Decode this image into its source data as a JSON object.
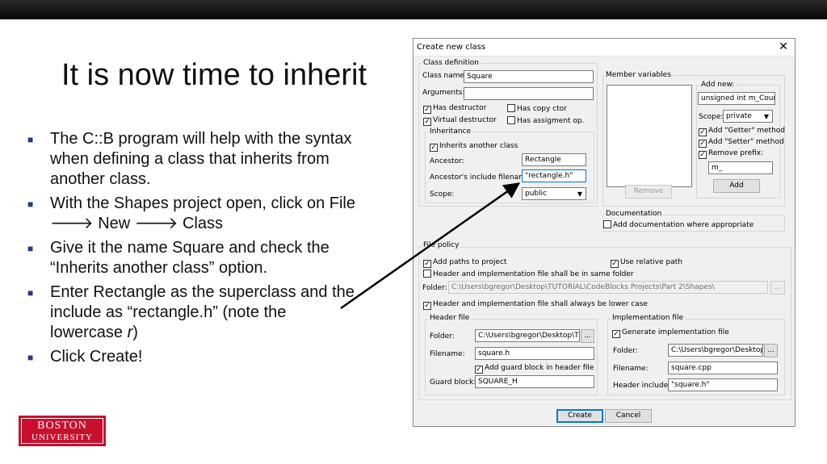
{
  "slide": {
    "title": "It is now time to inherit",
    "bullets": [
      "The C::B program will help with the syntax when defining a class that inherits from another class.",
      "With the Shapes project open, click on File",
      "Give it the name Square and check the “Inherits another class” option.",
      "Enter Rectangle as the superclass and the include as “rectangle.h”  (note the lowercase ",
      "Click Create!"
    ],
    "bullet2_parts": [
      "New",
      "Class"
    ],
    "bullet4_italic": "r",
    "bullet4_end": ")",
    "arrow_glyph": "🡒",
    "logo": {
      "line1": "BOSTON",
      "line2": "UNIVERSITY"
    }
  },
  "dialog": {
    "title": "Create new class",
    "close_glyph": "✕",
    "class_definition": {
      "label": "Class definition",
      "class_name_label": "Class name:",
      "class_name_value": "Square",
      "arguments_label": "Arguments:",
      "arguments_value": "",
      "has_destructor": "Has destructor",
      "has_copy_ctor": "Has copy ctor",
      "virtual_destructor": "Virtual destructor",
      "has_assignment_op": "Has assigment op."
    },
    "inheritance": {
      "label": "Inheritance",
      "inherits_label": "Inherits another class",
      "ancestor_label": "Ancestor:",
      "ancestor_value": "Rectangle",
      "include_label": "Ancestor's include filename:",
      "include_value": "\"rectangle.h\"",
      "scope_label": "Scope:",
      "scope_value": "public"
    },
    "member_variables": {
      "label": "Member variables",
      "add_new_label": "Add new:",
      "add_new_value": "unsigned int m_Counter",
      "scope_label": "Scope:",
      "scope_value": "private",
      "add_getter": "Add \"Getter\" method",
      "add_setter": "Add \"Setter\" method",
      "remove_prefix": "Remove prefix:",
      "prefix_value": "m_",
      "remove_button": "Remove",
      "add_button": "Add"
    },
    "documentation": {
      "label": "Documentation",
      "add_doc": "Add documentation where appropriate"
    },
    "file_policy": {
      "label": "File policy",
      "add_paths": "Add paths to project",
      "use_relative": "Use relative path",
      "same_folder": "Header and implementation file shall be in same folder",
      "folder_label": "Folder:",
      "folder_value": "C:\\Users\\bgregor\\Desktop\\TUTORIAL\\CodeBlocks Projects\\Part 2\\Shapes\\",
      "browse": "...",
      "lower_case": "Header and implementation file shall always be lower case"
    },
    "header_file": {
      "label": "Header file",
      "folder_label": "Folder:",
      "folder_value": "C:\\Users\\bgregor\\Desktop\\TUTC",
      "browse": "...",
      "filename_label": "Filename:",
      "filename_value": "square.h",
      "guard_check": "Add guard block in header file",
      "guard_label": "Guard block:",
      "guard_value": "SQUARE_H"
    },
    "implementation_file": {
      "label": "Implementation file",
      "generate": "Generate implementation file",
      "folder_label": "Folder:",
      "folder_value": "C:\\Users\\bgregor\\Desktop\\T",
      "browse": "...",
      "filename_label": "Filename:",
      "filename_value": "square.cpp",
      "header_include_label": "Header include:",
      "header_include_value": "\"square.h\""
    },
    "buttons": {
      "create": "Create",
      "cancel": "Cancel"
    },
    "check_glyph": "✓"
  }
}
